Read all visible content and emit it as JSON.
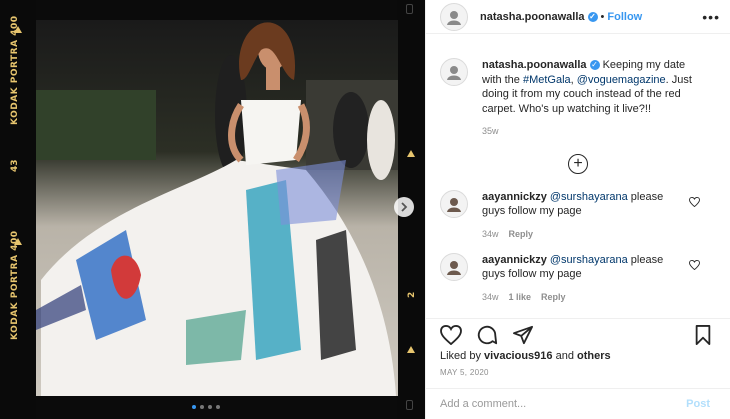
{
  "post": {
    "author": "natasha.poonawalla",
    "follow_label": "Follow",
    "separator": "•",
    "more_label": "•••",
    "caption_text_1": "Keeping my date with the ",
    "caption_tag": "#MetGala",
    "caption_text_2": ", ",
    "caption_mention": "@voguemagazine",
    "caption_text_3": ". Just doing it from my couch instead of the red carpet. Who's up watching it live?!!",
    "caption_time": "35w"
  },
  "film": {
    "left_top": "KODAK PORTRA 400",
    "left_num": "43",
    "left_bottom": "KODAK PORTRA 400",
    "right_num": "2"
  },
  "comments": [
    {
      "author": "aayannickzy",
      "mention": "@surshayarana",
      "text": "please guys follow my page",
      "time": "34w",
      "likes": "",
      "reply": "Reply"
    },
    {
      "author": "aayannickzy",
      "mention": "@surshayarana",
      "text": "please guys follow my page",
      "time": "34w",
      "likes": "1 like",
      "reply": "Reply"
    }
  ],
  "likes": {
    "prefix": "Liked by ",
    "user": "vivacious916",
    "joiner": " and ",
    "others": "others"
  },
  "date": "MAY 5, 2020",
  "comment_box": {
    "placeholder": "Add a comment...",
    "post_label": "Post"
  },
  "icons": {
    "like": "heart-icon",
    "comment": "comment-icon",
    "share": "share-icon",
    "save": "bookmark-icon",
    "load_more": "plus-circle-icon",
    "next": "chevron-right-icon"
  },
  "colors": {
    "accent": "#3897f0",
    "link": "#00376b",
    "muted": "#8e8e8e",
    "film_text": "#e7c56e"
  }
}
